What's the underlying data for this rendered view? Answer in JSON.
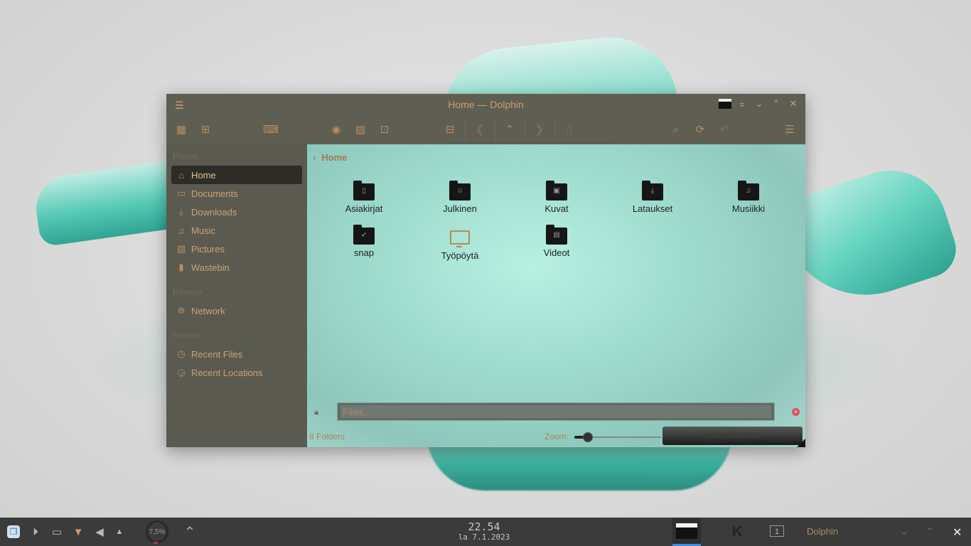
{
  "window": {
    "title": "Home — Dolphin"
  },
  "places": {
    "sections": {
      "places": "Places",
      "remote": "Remote",
      "recent": "Recent"
    },
    "items": [
      {
        "label": "Home"
      },
      {
        "label": "Documents"
      },
      {
        "label": "Downloads"
      },
      {
        "label": "Music"
      },
      {
        "label": "Pictures"
      },
      {
        "label": "Wastebin"
      }
    ],
    "remote_items": [
      {
        "label": "Network"
      }
    ],
    "recent_items": [
      {
        "label": "Recent Files"
      },
      {
        "label": "Recent Locations"
      }
    ]
  },
  "breadcrumb": {
    "current": "Home"
  },
  "files": [
    {
      "name": "Asiakirjat",
      "icon": "documents-folder-icon"
    },
    {
      "name": "Julkinen",
      "icon": "public-folder-icon"
    },
    {
      "name": "Kuvat",
      "icon": "pictures-folder-icon"
    },
    {
      "name": "Lataukset",
      "icon": "downloads-folder-icon"
    },
    {
      "name": "Musiikki",
      "icon": "music-folder-icon"
    },
    {
      "name": "snap",
      "icon": "snap-folder-icon"
    },
    {
      "name": "Työpöytä",
      "icon": "desktop-monitor-icon"
    },
    {
      "name": "Videot",
      "icon": "videos-folder-icon"
    }
  ],
  "filter": {
    "placeholder": "Filter..."
  },
  "status": {
    "summary": "8 Folders",
    "zoom_label": "Zoom:",
    "zoom_level": 0.15,
    "free_space": "259,0 GiB free"
  },
  "taskbar": {
    "cpu_load": "7,5%",
    "time": "22.54",
    "date": "la 7.1.2023",
    "desktop_number": "1",
    "active_task": "Dolphin"
  },
  "colors": {
    "accent": "#c89d6e",
    "panel": "#5b5a50",
    "view_bg": "#a6e3d6",
    "taskbar": "#3b3b3b"
  }
}
